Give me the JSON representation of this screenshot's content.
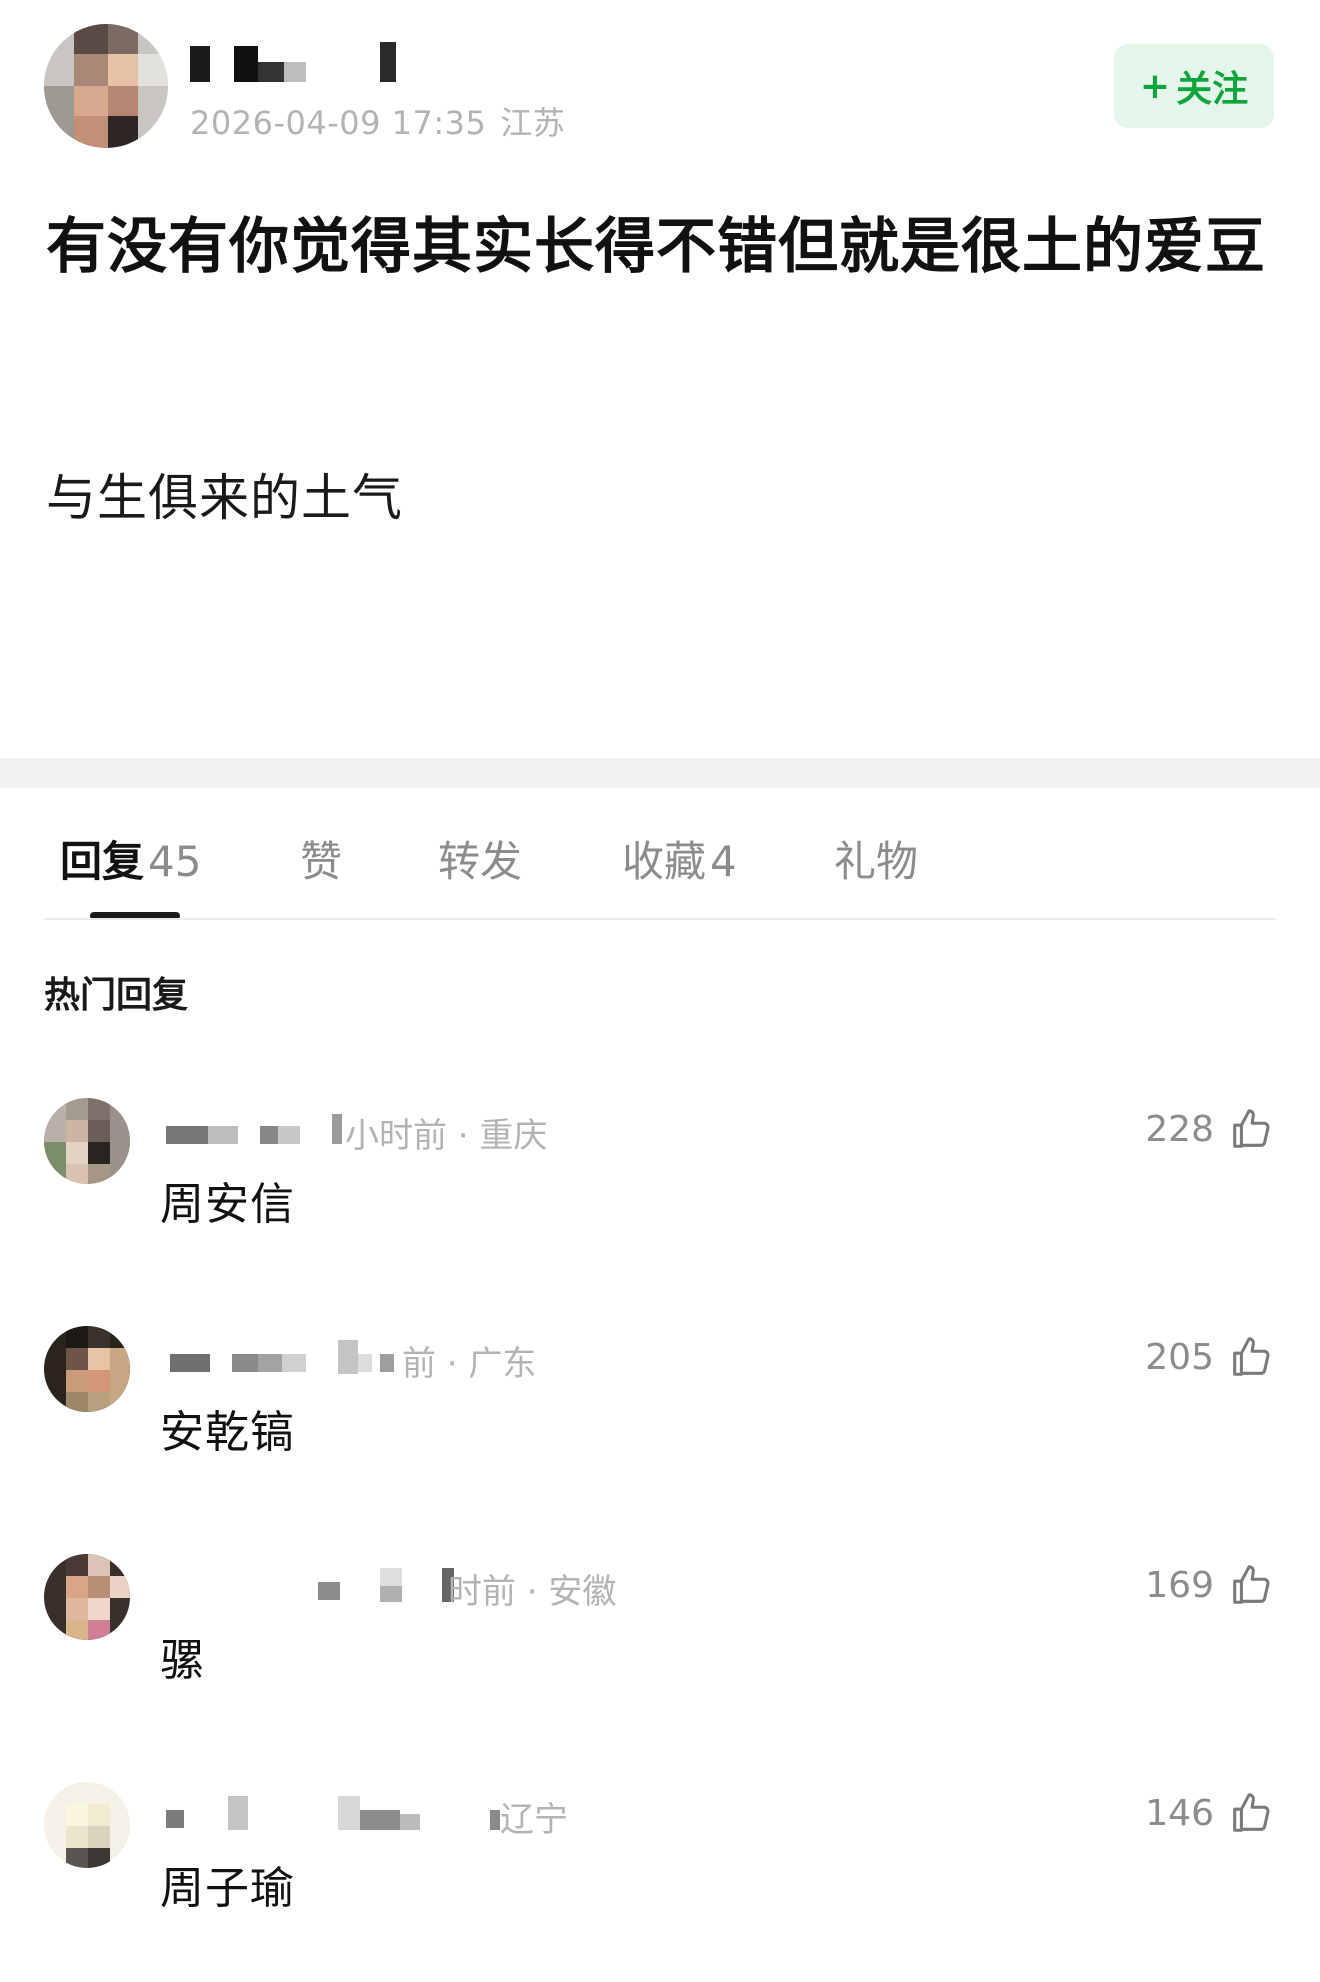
{
  "post": {
    "meta": "2026-04-09 17:35",
    "location": "江苏",
    "follow_plus": "+",
    "follow_label": "关注",
    "title": "有没有你觉得其实长得不错但就是很土的爱豆",
    "body": "与生俱来的土气"
  },
  "tabs": [
    {
      "label": "回复",
      "count": "45"
    },
    {
      "label": "赞",
      "count": ""
    },
    {
      "label": "转发",
      "count": ""
    },
    {
      "label": "收藏",
      "count": "4"
    },
    {
      "label": "礼物",
      "count": ""
    }
  ],
  "section_heading": "热门回复",
  "replies": [
    {
      "meta": "小时前 · 重庆",
      "text": "周安信",
      "likes": "228"
    },
    {
      "meta": "前 · 广东",
      "text": "安乾镐",
      "likes": "205"
    },
    {
      "meta": "时前 · 安徽",
      "text": "骡",
      "likes": "169"
    },
    {
      "meta": "辽宁",
      "text": "周子瑜",
      "likes": "146"
    }
  ],
  "icons": {
    "like": "thumbs-up-icon"
  },
  "colors": {
    "accent_green": "#0fa43c",
    "follow_bg": "#e4f5e9",
    "muted_text": "#b3b3b3"
  }
}
